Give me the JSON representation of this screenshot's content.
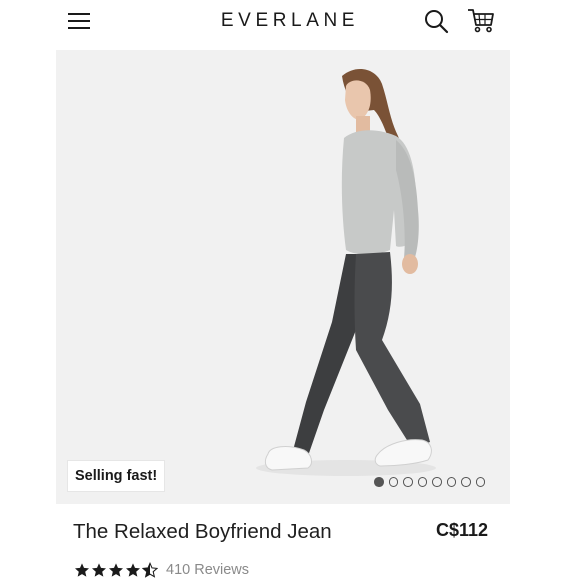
{
  "header": {
    "brand": "EVERLANE",
    "menu_icon": "hamburger-menu-icon",
    "search_icon": "search-icon",
    "cart_icon": "shopping-cart-icon"
  },
  "hero": {
    "badge": "Selling fast!",
    "image_count": 8,
    "active_image_index": 0,
    "background_color": "#f1f1f1"
  },
  "product": {
    "title": "The Relaxed Boyfriend Jean",
    "price": "C$112",
    "rating": 4.5,
    "rating_max": 5,
    "reviews": "410 Reviews"
  }
}
